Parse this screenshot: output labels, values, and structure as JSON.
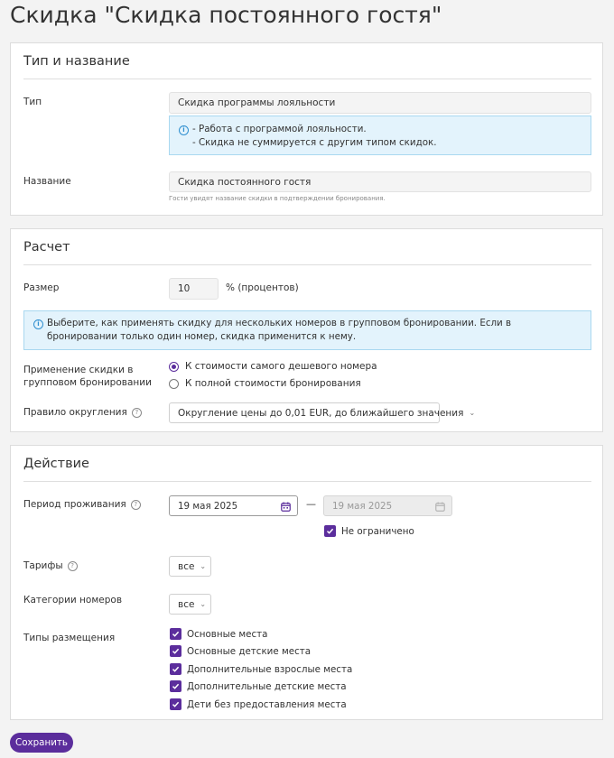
{
  "page": {
    "title": "Скидка \"Скидка постоянного гостя\""
  },
  "type_section": {
    "title": "Тип и название",
    "type_label": "Тип",
    "type_value": "Скидка программы лояльности",
    "info_lines": [
      "- Работа с программой лояльности.",
      "- Скидка не суммируется с другим типом скидок."
    ],
    "name_label": "Название",
    "name_value": "Скидка постоянного гостя",
    "name_hint": "Гости увидят название скидки в подтверждении бронирования."
  },
  "calc_section": {
    "title": "Расчет",
    "size_label": "Размер",
    "size_value": "10",
    "size_unit": "% (процентов)",
    "info": "Выберите, как применять скидку для нескольких номеров в групповом бронировании. Если в бронировании только один номер, скидка применится к нему.",
    "group_label": "Применение скидки в групповом бронировании",
    "group_options": [
      {
        "label": "К стоимости самого дешевого номера",
        "selected": true
      },
      {
        "label": "К полной стоимости бронирования",
        "selected": false
      }
    ],
    "rounding_label": "Правило округления",
    "rounding_value": "Округление цены до 0,01 EUR, до ближайшего значения"
  },
  "action_section": {
    "title": "Действие",
    "period_label": "Период проживания",
    "date_from": "19 мая 2025",
    "date_to": "19 мая 2025",
    "date_separator": "—",
    "unlimited_label": "Не ограничено",
    "unlimited_checked": true,
    "tariffs_label": "Тарифы",
    "tariffs_value": "все",
    "room_categories_label": "Категории номеров",
    "room_categories_value": "все",
    "accommodation_label": "Типы размещения",
    "accommodation_types": [
      {
        "label": "Основные места",
        "checked": true
      },
      {
        "label": "Основные детские места",
        "checked": true
      },
      {
        "label": "Дополнительные взрослые места",
        "checked": true
      },
      {
        "label": "Дополнительные детские места",
        "checked": true
      },
      {
        "label": "Дети без предоставления места",
        "checked": true
      }
    ]
  },
  "footer": {
    "save_label": "Сохранить"
  },
  "colors": {
    "accent": "#5b2d9c",
    "info_bg": "#e3f3fc",
    "info_border": "#a9d8f0",
    "info_icon": "#2f8fd0"
  }
}
